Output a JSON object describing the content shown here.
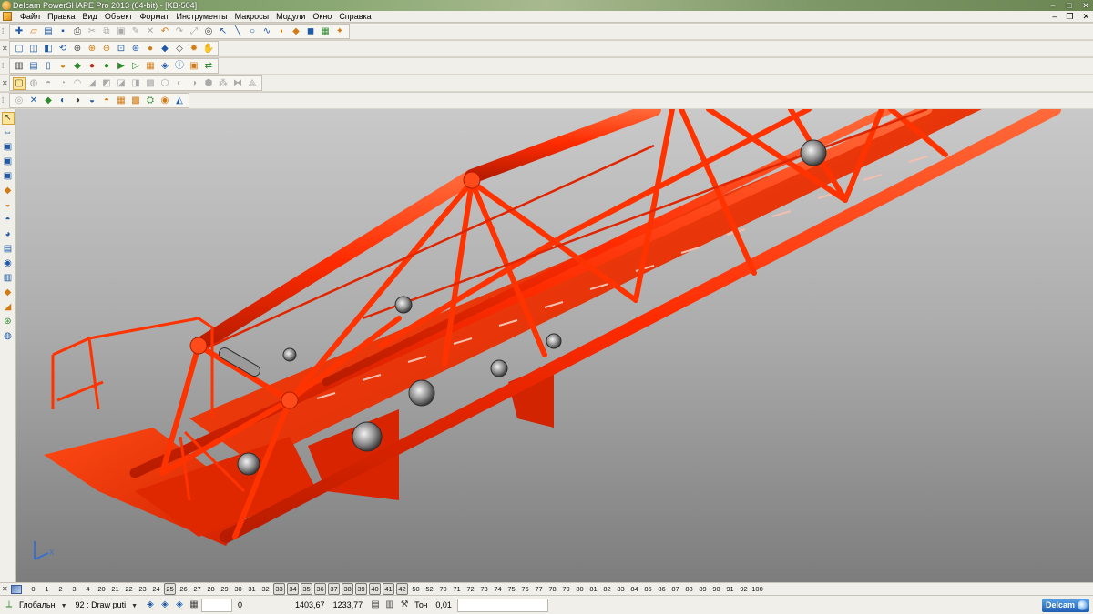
{
  "window": {
    "title": "Delcam PowerSHAPE Pro 2013 (64-bit) - [KB-504]",
    "controls": {
      "minimize": "–",
      "maximize": "□",
      "close": "✕"
    }
  },
  "menu": {
    "items": [
      "Файл",
      "Правка",
      "Вид",
      "Объект",
      "Формат",
      "Инструменты",
      "Макросы",
      "Модули",
      "Окно",
      "Справка"
    ],
    "doc_controls": {
      "minimize": "–",
      "restore": "❐",
      "close": "✕"
    }
  },
  "toolbars": {
    "row1": [
      {
        "icon": "new-file-icon",
        "glyph": "✚",
        "tone": ""
      },
      {
        "icon": "open-folder-icon",
        "glyph": "▱",
        "tone": "o"
      },
      {
        "icon": "open-model-icon",
        "glyph": "▤",
        "tone": ""
      },
      {
        "icon": "save-icon",
        "glyph": "▪",
        "tone": ""
      },
      {
        "icon": "print-icon",
        "glyph": "⎙",
        "tone": "k"
      },
      {
        "icon": "cut-icon",
        "glyph": "✂",
        "tone": "d"
      },
      {
        "icon": "copy-icon",
        "glyph": "⧉",
        "tone": "d"
      },
      {
        "icon": "paste-icon",
        "glyph": "▣",
        "tone": "d"
      },
      {
        "icon": "edit-icon",
        "glyph": "✎",
        "tone": "d"
      },
      {
        "icon": "delete-icon",
        "glyph": "✕",
        "tone": "d"
      },
      {
        "icon": "undo-icon",
        "glyph": "↶",
        "tone": "o"
      },
      {
        "icon": "redo-icon",
        "glyph": "↷",
        "tone": "d"
      },
      {
        "icon": "transform-icon",
        "glyph": "⤢",
        "tone": "d"
      },
      {
        "icon": "binoculars-icon",
        "glyph": "◎",
        "tone": "k"
      },
      {
        "icon": "select-icon",
        "glyph": "↖",
        "tone": ""
      },
      {
        "icon": "line-icon",
        "glyph": "╲",
        "tone": ""
      },
      {
        "icon": "circle-icon",
        "glyph": "○",
        "tone": ""
      },
      {
        "icon": "curve-icon",
        "glyph": "∿",
        "tone": ""
      },
      {
        "icon": "surface-icon",
        "glyph": "◗",
        "tone": "o"
      },
      {
        "icon": "solid-icon",
        "glyph": "◆",
        "tone": "o"
      },
      {
        "icon": "shading-icon",
        "glyph": "◼",
        "tone": ""
      },
      {
        "icon": "layer-icon",
        "glyph": "▦",
        "tone": "g"
      },
      {
        "icon": "wizard-icon",
        "glyph": "✦",
        "tone": "o"
      }
    ],
    "row2": [
      {
        "icon": "cube-front-icon",
        "glyph": "▢",
        "tone": ""
      },
      {
        "icon": "cube-iso-icon",
        "glyph": "◫",
        "tone": ""
      },
      {
        "icon": "cube-top-icon",
        "glyph": "◧",
        "tone": ""
      },
      {
        "icon": "cube-rotate-icon",
        "glyph": "⟲",
        "tone": ""
      },
      {
        "icon": "zoom-window-icon",
        "glyph": "⊕",
        "tone": "k"
      },
      {
        "icon": "zoom-in-icon",
        "glyph": "⊕",
        "tone": "o"
      },
      {
        "icon": "zoom-out-icon",
        "glyph": "⊖",
        "tone": "o"
      },
      {
        "icon": "fit-view-icon",
        "glyph": "⊡",
        "tone": ""
      },
      {
        "icon": "globe-icon",
        "glyph": "⊛",
        "tone": ""
      },
      {
        "icon": "shaded-sphere-icon",
        "glyph": "●",
        "tone": "o"
      },
      {
        "icon": "shaded-solid-icon",
        "glyph": "◆",
        "tone": ""
      },
      {
        "icon": "wireframe-icon",
        "glyph": "◇",
        "tone": "k"
      },
      {
        "icon": "light-bulb-icon",
        "glyph": "✹",
        "tone": "o"
      },
      {
        "icon": "hand-icon",
        "glyph": "✋",
        "tone": "d"
      }
    ],
    "row3": [
      {
        "icon": "model-tree-icon",
        "glyph": "▥",
        "tone": "k"
      },
      {
        "icon": "report-icon",
        "glyph": "▤",
        "tone": ""
      },
      {
        "icon": "document-icon",
        "glyph": "▯",
        "tone": ""
      },
      {
        "icon": "surface-tool-icon",
        "glyph": "◒",
        "tone": "o"
      },
      {
        "icon": "solid-tool-icon",
        "glyph": "◆",
        "tone": "g"
      },
      {
        "icon": "red-ball-icon",
        "glyph": "●",
        "tone": "r"
      },
      {
        "icon": "green-ball-icon",
        "glyph": "●",
        "tone": "g"
      },
      {
        "icon": "play-icon",
        "glyph": "▶",
        "tone": "g"
      },
      {
        "icon": "play-outline-icon",
        "glyph": "▷",
        "tone": "g"
      },
      {
        "icon": "assembly-icon",
        "glyph": "▦",
        "tone": "o"
      },
      {
        "icon": "feature-icon",
        "glyph": "◈",
        "tone": ""
      },
      {
        "icon": "info-icon",
        "glyph": "ⓘ",
        "tone": ""
      },
      {
        "icon": "electrode-icon",
        "glyph": "▣",
        "tone": "o"
      },
      {
        "icon": "arrows-icon",
        "glyph": "⇄",
        "tone": "g"
      }
    ],
    "row4": [
      {
        "icon": "sketch-icon",
        "glyph": "▢",
        "tone": "k",
        "selected": true
      },
      {
        "icon": "shell-icon",
        "glyph": "◍",
        "tone": "d"
      },
      {
        "icon": "extrude-icon",
        "glyph": "◓",
        "tone": "d"
      },
      {
        "icon": "revolve-icon",
        "glyph": "◔",
        "tone": "d"
      },
      {
        "icon": "fillet-icon",
        "glyph": "◠",
        "tone": "d"
      },
      {
        "icon": "chamfer-icon",
        "glyph": "◢",
        "tone": "d"
      },
      {
        "icon": "boolean-add-icon",
        "glyph": "◩",
        "tone": "d"
      },
      {
        "icon": "boolean-sub-icon",
        "glyph": "◪",
        "tone": "d"
      },
      {
        "icon": "boolean-int-icon",
        "glyph": "◨",
        "tone": "d"
      },
      {
        "icon": "mesh-icon",
        "glyph": "▩",
        "tone": "d"
      },
      {
        "icon": "morph-icon",
        "glyph": "⬡",
        "tone": "d"
      },
      {
        "icon": "split-icon",
        "glyph": "◐",
        "tone": "d"
      },
      {
        "icon": "offset-icon",
        "glyph": "◑",
        "tone": "d"
      },
      {
        "icon": "thicken-icon",
        "glyph": "⬢",
        "tone": "d"
      },
      {
        "icon": "pattern-icon",
        "glyph": "⁂",
        "tone": "d"
      },
      {
        "icon": "mirror-icon",
        "glyph": "⧓",
        "tone": "d"
      },
      {
        "icon": "draft-icon",
        "glyph": "⟁",
        "tone": "d"
      }
    ],
    "row5": [
      {
        "icon": "reflection-icon",
        "glyph": "◎",
        "tone": "d"
      },
      {
        "icon": "curvature-icon",
        "glyph": "✕",
        "tone": ""
      },
      {
        "icon": "draft-analysis-icon",
        "glyph": "◆",
        "tone": "g"
      },
      {
        "icon": "thickness-icon",
        "glyph": "◐",
        "tone": ""
      },
      {
        "icon": "undercut-icon",
        "glyph": "◑",
        "tone": "k"
      },
      {
        "icon": "smoothness-icon",
        "glyph": "◒",
        "tone": ""
      },
      {
        "icon": "deviation-icon",
        "glyph": "◓",
        "tone": "o"
      },
      {
        "icon": "grid-analysis-icon",
        "glyph": "▦",
        "tone": "o"
      },
      {
        "icon": "texture-icon",
        "glyph": "▩",
        "tone": "o"
      },
      {
        "icon": "fitter-icon",
        "glyph": "⛭",
        "tone": "g"
      },
      {
        "icon": "render-icon",
        "glyph": "◉",
        "tone": "o"
      },
      {
        "icon": "ray-trace-icon",
        "glyph": "◭",
        "tone": ""
      }
    ]
  },
  "left_toolbar": [
    {
      "icon": "select-arrow-icon",
      "glyph": "↖",
      "tone": "k",
      "selected": true
    },
    {
      "icon": "select-filter-icon",
      "glyph": "⇔",
      "tone": ""
    },
    {
      "icon": "layer-stack-icon",
      "glyph": "▣",
      "tone": ""
    },
    {
      "icon": "layer-copy-icon",
      "glyph": "▣",
      "tone": ""
    },
    {
      "icon": "workplane-icon",
      "glyph": "▣",
      "tone": ""
    },
    {
      "icon": "surface-edit-icon",
      "glyph": "◆",
      "tone": "o"
    },
    {
      "icon": "solid-edit-icon",
      "glyph": "◒",
      "tone": "o"
    },
    {
      "icon": "hat-icon",
      "glyph": "◓",
      "tone": ""
    },
    {
      "icon": "sphere-tool-icon",
      "glyph": "◕",
      "tone": ""
    },
    {
      "icon": "box-tool-icon",
      "glyph": "▤",
      "tone": ""
    },
    {
      "icon": "cylinder-icon",
      "glyph": "◉",
      "tone": ""
    },
    {
      "icon": "block-icon",
      "glyph": "▥",
      "tone": ""
    },
    {
      "icon": "gem-icon",
      "glyph": "◆",
      "tone": "o"
    },
    {
      "icon": "cone-icon",
      "glyph": "◢",
      "tone": "o"
    },
    {
      "icon": "globe-tool-icon",
      "glyph": "⊛",
      "tone": "g"
    },
    {
      "icon": "earth-icon",
      "glyph": "◍",
      "tone": ""
    }
  ],
  "levels": [
    {
      "n": "0",
      "boxed": false
    },
    {
      "n": "1",
      "boxed": false
    },
    {
      "n": "2",
      "boxed": false
    },
    {
      "n": "3",
      "boxed": false
    },
    {
      "n": "4",
      "boxed": false
    },
    {
      "n": "20",
      "boxed": false
    },
    {
      "n": "21",
      "boxed": false
    },
    {
      "n": "22",
      "boxed": false
    },
    {
      "n": "23",
      "boxed": false
    },
    {
      "n": "24",
      "boxed": false
    },
    {
      "n": "25",
      "boxed": true
    },
    {
      "n": "26",
      "boxed": false
    },
    {
      "n": "27",
      "boxed": false
    },
    {
      "n": "28",
      "boxed": false
    },
    {
      "n": "29",
      "boxed": false
    },
    {
      "n": "30",
      "boxed": false
    },
    {
      "n": "31",
      "boxed": false
    },
    {
      "n": "32",
      "boxed": false
    },
    {
      "n": "33",
      "boxed": true
    },
    {
      "n": "34",
      "boxed": true
    },
    {
      "n": "35",
      "boxed": true
    },
    {
      "n": "36",
      "boxed": true
    },
    {
      "n": "37",
      "boxed": true
    },
    {
      "n": "38",
      "boxed": true
    },
    {
      "n": "39",
      "boxed": true
    },
    {
      "n": "40",
      "boxed": true
    },
    {
      "n": "41",
      "boxed": true
    },
    {
      "n": "42",
      "boxed": true
    },
    {
      "n": "50",
      "boxed": false
    },
    {
      "n": "52",
      "boxed": false
    },
    {
      "n": "70",
      "boxed": false
    },
    {
      "n": "71",
      "boxed": false
    },
    {
      "n": "72",
      "boxed": false
    },
    {
      "n": "73",
      "boxed": false
    },
    {
      "n": "74",
      "boxed": false
    },
    {
      "n": "75",
      "boxed": false
    },
    {
      "n": "76",
      "boxed": false
    },
    {
      "n": "77",
      "boxed": false
    },
    {
      "n": "78",
      "boxed": false
    },
    {
      "n": "79",
      "boxed": false
    },
    {
      "n": "80",
      "boxed": false
    },
    {
      "n": "81",
      "boxed": false
    },
    {
      "n": "82",
      "boxed": false
    },
    {
      "n": "83",
      "boxed": false
    },
    {
      "n": "84",
      "boxed": false
    },
    {
      "n": "85",
      "boxed": false
    },
    {
      "n": "86",
      "boxed": false
    },
    {
      "n": "87",
      "boxed": false
    },
    {
      "n": "88",
      "boxed": false
    },
    {
      "n": "89",
      "boxed": false
    },
    {
      "n": "90",
      "boxed": false
    },
    {
      "n": "91",
      "boxed": false
    },
    {
      "n": "92",
      "boxed": false
    },
    {
      "n": "100",
      "boxed": false
    }
  ],
  "status": {
    "workplane": "Глобальн",
    "level_number": "92",
    "level_name": ": Draw puti",
    "coord_0": "0",
    "coord_x": "1403,67",
    "coord_y": "1233,77",
    "tolerance_label": "Точ",
    "tolerance_value": "0,01",
    "brand": "Delcam"
  },
  "viewport": {
    "model_color": "#ff2b00",
    "axis_label": "X"
  }
}
